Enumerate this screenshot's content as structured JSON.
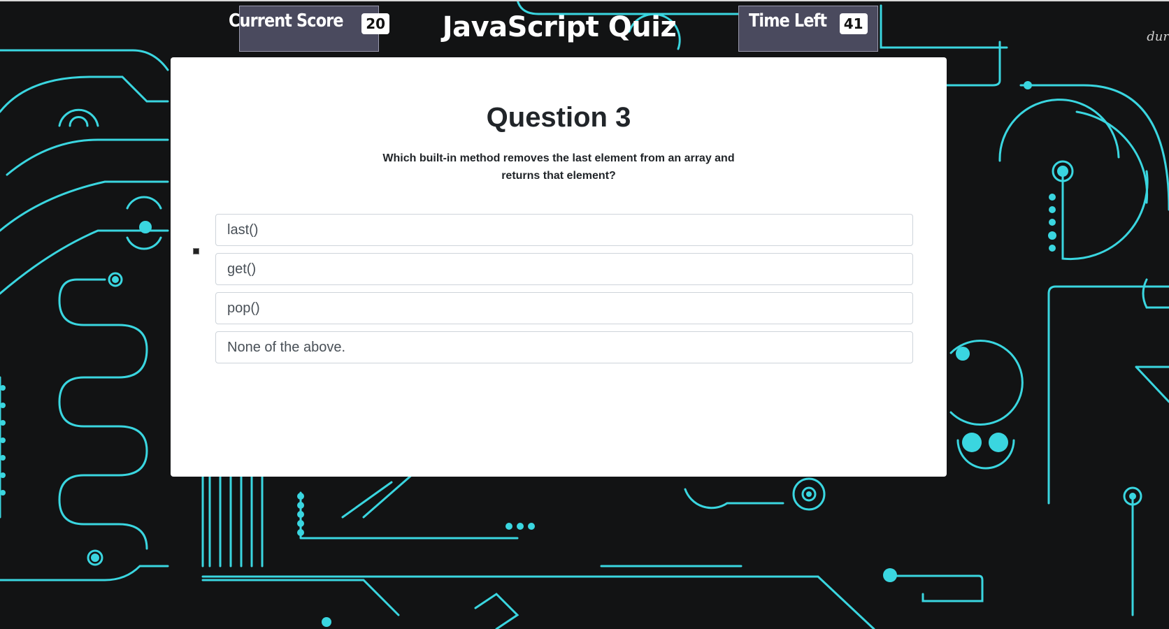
{
  "header": {
    "title": "JavaScript Quiz",
    "score_label": "Current Score",
    "score_value": "20",
    "time_label": "Time Left",
    "time_value": "41",
    "corner_text": "dur"
  },
  "quiz": {
    "question_title": "Question 3",
    "question_text": "Which built-in method removes the last element from an array and returns that element?",
    "answers": [
      "last()",
      "get()",
      "pop()",
      "None of the above."
    ]
  },
  "colors": {
    "background": "#121314",
    "circuit": "#3ad6e0",
    "hud_box": "#4a4a5e",
    "card": "#ffffff"
  }
}
